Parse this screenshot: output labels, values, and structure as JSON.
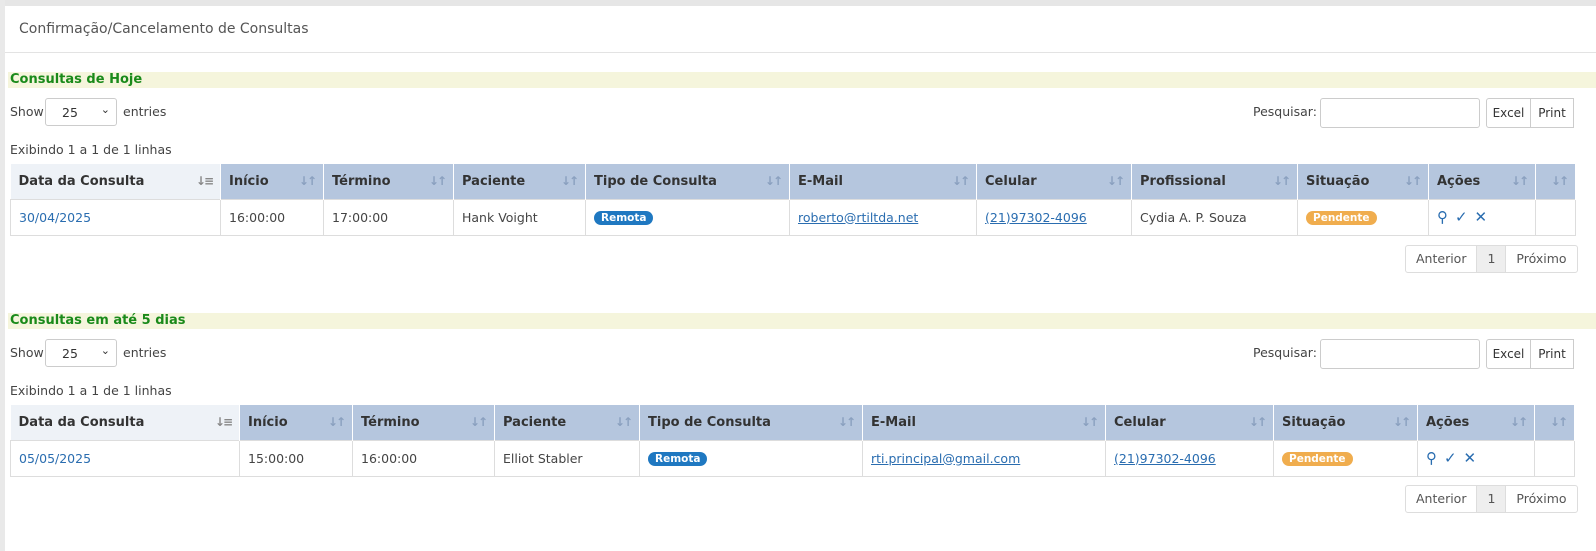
{
  "page": {
    "title": "Confirmação/Cancelamento de Consultas"
  },
  "sections": [
    {
      "title": "Consultas de Hoje",
      "show_label": "Show",
      "entries_value": "25",
      "entries_label": "entries",
      "search_label": "Pesquisar:",
      "search_value": "",
      "excel_label": "Excel",
      "print_label": "Print",
      "info": "Exibindo 1 a 1 de 1 linhas",
      "columns": [
        "Data da Consulta",
        "Início",
        "Término",
        "Paciente",
        "Tipo de Consulta",
        "E-Mail",
        "Celular",
        "Profissional",
        "Situação",
        "Ações"
      ],
      "row": {
        "data": "30/04/2025",
        "inicio": "16:00:00",
        "termino": "17:00:00",
        "paciente": "Hank Voight",
        "tipo": "Remota",
        "email": "roberto@rtiltda.net",
        "celular": "(21)97302-4096",
        "profissional": "Cydia A. P. Souza",
        "situacao": "Pendente"
      },
      "pager": {
        "prev": "Anterior",
        "page": "1",
        "next": "Próximo"
      }
    },
    {
      "title": "Consultas em até 5 dias",
      "show_label": "Show",
      "entries_value": "25",
      "entries_label": "entries",
      "search_label": "Pesquisar:",
      "search_value": "",
      "excel_label": "Excel",
      "print_label": "Print",
      "info": "Exibindo 1 a 1 de 1 linhas",
      "columns": [
        "Data da Consulta",
        "Início",
        "Término",
        "Paciente",
        "Tipo de Consulta",
        "E-Mail",
        "Celular",
        "Situação",
        "Ações"
      ],
      "row": {
        "data": "05/05/2025",
        "inicio": "15:00:00",
        "termino": "16:00:00",
        "paciente": "Elliot Stabler",
        "tipo": "Remota",
        "email": "rti.principal@gmail.com",
        "celular": "(21)97302-4096",
        "situacao": "Pendente"
      },
      "pager": {
        "prev": "Anterior",
        "page": "1",
        "next": "Próximo"
      }
    }
  ],
  "icons": {
    "view": "search-icon",
    "confirm": "check-icon",
    "cancel": "close-icon"
  },
  "colors": {
    "header": "#b5c6de",
    "section_bg": "#f5f5dc",
    "section_title": "#1a8a1a",
    "badge_blue": "#1f78c1",
    "badge_orange": "#f0ad4e",
    "link": "#2a6db0"
  }
}
